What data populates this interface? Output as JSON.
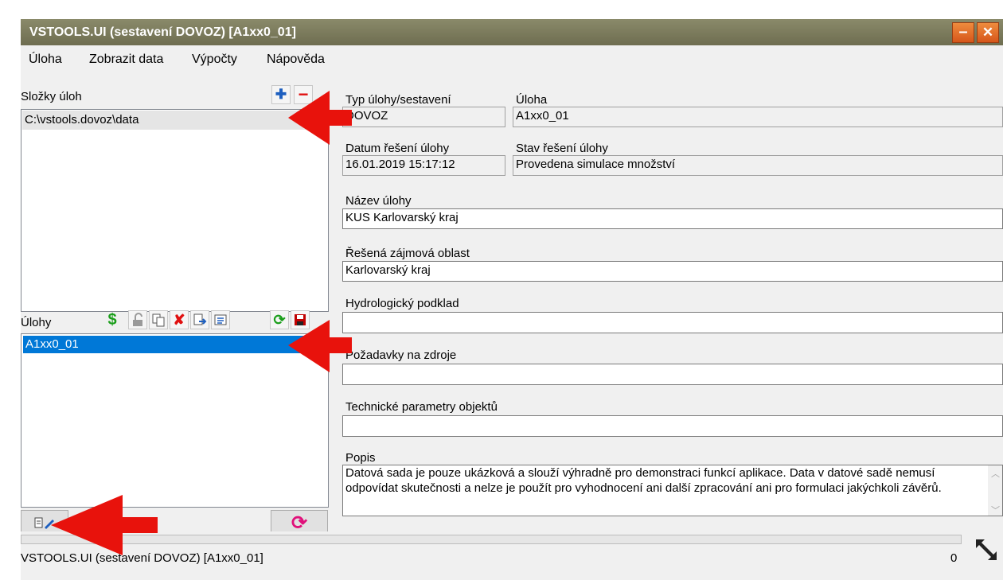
{
  "window": {
    "title": "VSTOOLS.UI (sestavení DOVOZ) [A1xx0_01]",
    "minimize_glyph": "–",
    "close_glyph": "✕"
  },
  "menu": {
    "items": [
      "Úloha",
      "Zobrazit data",
      "Výpočty",
      "Nápověda"
    ]
  },
  "folders": {
    "label": "Složky úloh",
    "add_glyph": "✚",
    "remove_glyph": "−",
    "items": [
      "C:\\vstools.dovoz\\data"
    ]
  },
  "tasks": {
    "label": "Úlohy",
    "items": [
      "A1xx0_01"
    ],
    "toolbar_icons": [
      "dollar-icon",
      "unlock-icon",
      "copy-icon",
      "delete-icon",
      "export-icon",
      "list-icon",
      "refresh-icon",
      "save-icon"
    ]
  },
  "details": {
    "type_label": "Typ úlohy/sestavení",
    "type_value": "DOVOZ",
    "task_label": "Úloha",
    "task_value": "A1xx0_01",
    "date_label": "Datum řešení úlohy",
    "date_value": "16.01.2019 15:17:12",
    "state_label": "Stav řešení úlohy",
    "state_value": "Provedena simulace množství",
    "name_label": "Název úlohy",
    "name_value": "KUS Karlovarský kraj",
    "area_label": "Řešená zájmová oblast",
    "area_value": "Karlovarský kraj",
    "hydro_label": "Hydrologický podklad",
    "hydro_value": "",
    "req_label": "Požadavky na zdroje",
    "req_value": "",
    "tech_label": "Technické parametry objektů",
    "tech_value": "",
    "desc_label": "Popis",
    "desc_value": "Datová sada je pouze ukázková a slouží výhradně pro demonstraci funkcí aplikace. Data v datové sadě nemusí odpovídat skutečnosti a nelze je použít pro vyhodnocení ani další zpracování ani pro formulaci jakýchkoli závěrů."
  },
  "status": {
    "text": "VSTOOLS.UI (sestavení DOVOZ) [A1xx0_01]",
    "count": "0",
    "progress": 0
  },
  "colors": {
    "titlebar": "#6e6d50",
    "selection": "#0078d7",
    "arrow": "#e8120c"
  }
}
